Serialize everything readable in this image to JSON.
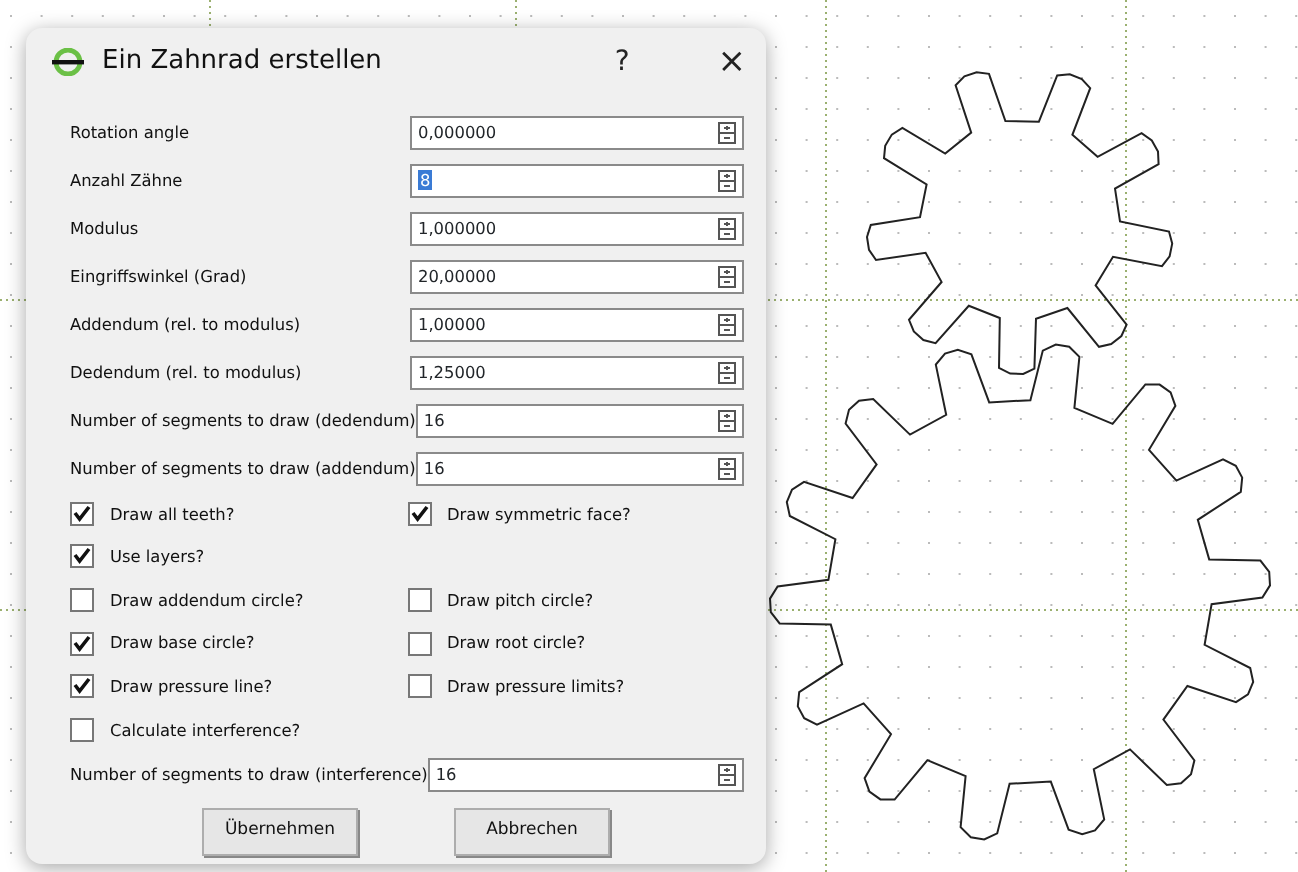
{
  "dialog": {
    "title": "Ein Zahnrad erstellen",
    "help": "?",
    "close": "×"
  },
  "form": [
    {
      "kind": "spin",
      "label": "Rotation angle",
      "value": "0,000000",
      "selected": false
    },
    {
      "kind": "spin",
      "label": "Anzahl Zähne",
      "value": "8",
      "selected": true
    },
    {
      "kind": "spin",
      "label": "Modulus",
      "value": "1,000000",
      "selected": false
    },
    {
      "kind": "spin",
      "label": "Eingriffswinkel (Grad)",
      "value": "20,00000",
      "selected": false
    },
    {
      "kind": "spin",
      "label": "Addendum (rel. to modulus)",
      "value": "1,00000",
      "selected": false
    },
    {
      "kind": "spin",
      "label": "Dedendum (rel. to modulus)",
      "value": "1,25000",
      "selected": false
    },
    {
      "kind": "spin",
      "label": "Number of segments to draw (dedendum)",
      "value": "16",
      "selected": false
    },
    {
      "kind": "spin",
      "label": "Number of segments to draw (addendum)",
      "value": "16",
      "selected": false
    },
    {
      "kind": "checks",
      "items": [
        {
          "label": "Draw all teeth?",
          "checked": true
        },
        {
          "label": "Draw symmetric face?",
          "checked": true
        }
      ]
    },
    {
      "kind": "checks",
      "items": [
        {
          "label": "Use layers?",
          "checked": true
        }
      ]
    },
    {
      "kind": "checks",
      "items": [
        {
          "label": "Draw addendum circle?",
          "checked": false
        },
        {
          "label": "Draw pitch circle?",
          "checked": false
        }
      ]
    },
    {
      "kind": "checks",
      "items": [
        {
          "label": "Draw base circle?",
          "checked": true
        },
        {
          "label": "Draw root circle?",
          "checked": false
        }
      ]
    },
    {
      "kind": "checks",
      "items": [
        {
          "label": "Draw pressure line?",
          "checked": true
        },
        {
          "label": "Draw pressure limits?",
          "checked": false
        }
      ]
    },
    {
      "kind": "checks",
      "items": [
        {
          "label": "Calculate interference?",
          "checked": false
        }
      ]
    },
    {
      "kind": "spin",
      "label": "Number of segments to draw (interference)",
      "value": "16",
      "selected": false
    }
  ],
  "buttons": [
    "Übernehmen",
    "Abbrechen"
  ]
}
